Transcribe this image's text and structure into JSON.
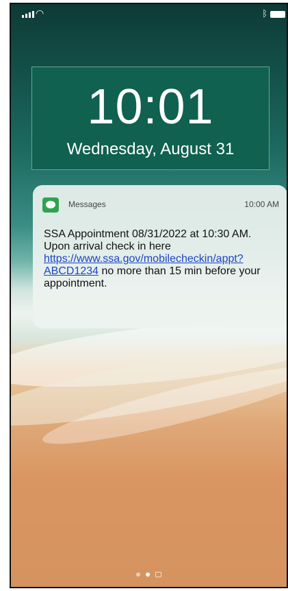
{
  "lockscreen": {
    "time": "10:01",
    "date": "Wednesday, August 31"
  },
  "status_bar": {
    "signal_icon": "signal-icon",
    "wifi_icon": "wifi-icon",
    "bluetooth_icon": "bluetooth-icon",
    "battery_icon": "battery-icon"
  },
  "notification": {
    "app_name": "Messages",
    "time": "10:00 AM",
    "body_before": "SSA Appointment 08/31/2022 at 10:30 AM. Upon arrival check in here ",
    "link": "https://www.ssa.gov/mobilecheckin/appt?ABCD1234",
    "body_after": " no more than 15 min before your appointment.",
    "icon": "messages-app-icon"
  },
  "page_indicator": {
    "pages": 3,
    "active_index": 1
  }
}
